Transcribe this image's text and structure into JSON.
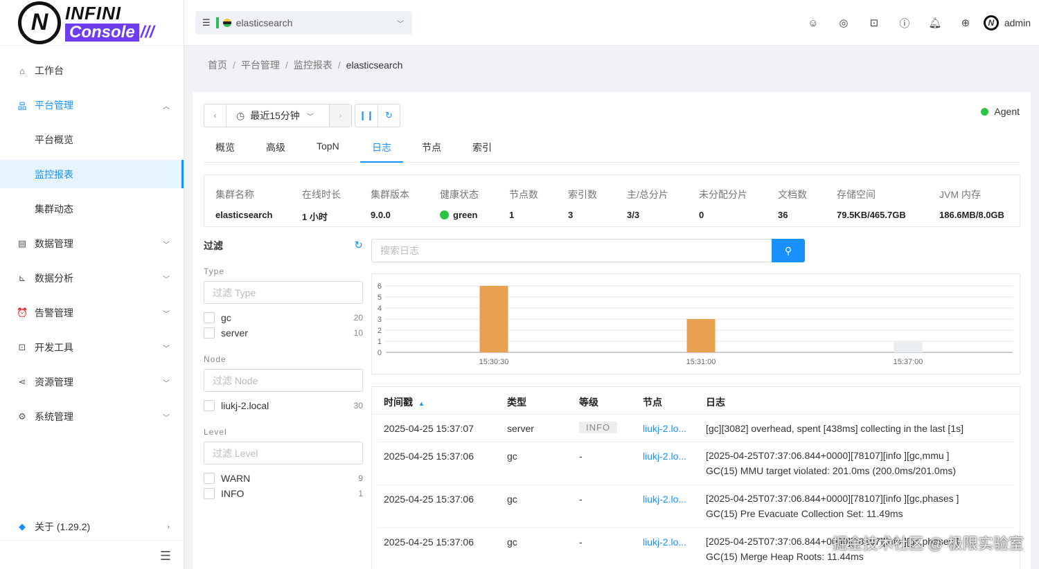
{
  "logo": {
    "text1": "INFINI",
    "text2": "Console",
    "slashes": "///"
  },
  "sidebar": {
    "items": [
      {
        "label": "工作台",
        "icon": "home-icon"
      },
      {
        "label": "平台管理",
        "icon": "cluster-icon"
      },
      {
        "label": "平台概览"
      },
      {
        "label": "监控报表"
      },
      {
        "label": "集群动态"
      },
      {
        "label": "数据管理",
        "icon": "database-icon"
      },
      {
        "label": "数据分析",
        "icon": "chart-icon"
      },
      {
        "label": "告警管理",
        "icon": "alarm-icon"
      },
      {
        "label": "开发工具",
        "icon": "terminal-icon"
      },
      {
        "label": "资源管理",
        "icon": "share-icon"
      },
      {
        "label": "系统管理",
        "icon": "gear-icon"
      },
      {
        "label": "关于 (1.29.2)",
        "icon": "diamond-icon"
      }
    ]
  },
  "header": {
    "cluster": "elasticsearch",
    "user": "admin"
  },
  "breadcrumb": [
    "首页",
    "平台管理",
    "监控报表",
    "elasticsearch"
  ],
  "toolbar": {
    "time_range": "最近15分钟"
  },
  "agent": {
    "label": "Agent",
    "color": "#29c541"
  },
  "tabs": [
    "概览",
    "高级",
    "TopN",
    "日志",
    "节点",
    "索引"
  ],
  "stats": [
    {
      "label": "集群名称",
      "value": "elasticsearch"
    },
    {
      "label": "在线时长",
      "value": "1 小时"
    },
    {
      "label": "集群版本",
      "value": "9.0.0"
    },
    {
      "label": "健康状态",
      "value": "green"
    },
    {
      "label": "节点数",
      "value": "1"
    },
    {
      "label": "索引数",
      "value": "3"
    },
    {
      "label": "主/总分片",
      "value": "3/3"
    },
    {
      "label": "未分配分片",
      "value": "0"
    },
    {
      "label": "文档数",
      "value": "36"
    },
    {
      "label": "存储空间",
      "value": "79.5KB/465.7GB"
    },
    {
      "label": "JVM 内存",
      "value": "186.6MB/8.0GB"
    }
  ],
  "filter": {
    "title": "过滤",
    "type": {
      "label": "Type",
      "placeholder": "过滤 Type",
      "options": [
        {
          "name": "gc",
          "count": "20"
        },
        {
          "name": "server",
          "count": "10"
        }
      ]
    },
    "node": {
      "label": "Node",
      "placeholder": "过滤 Node",
      "options": [
        {
          "name": "liukj-2.local",
          "count": "30"
        }
      ]
    },
    "level": {
      "label": "Level",
      "placeholder": "过滤 Level",
      "options": [
        {
          "name": "WARN",
          "count": "9"
        },
        {
          "name": "INFO",
          "count": "1"
        }
      ]
    }
  },
  "search": {
    "placeholder": "搜索日志"
  },
  "chart_data": {
    "type": "bar",
    "categories": [
      "15:30:30",
      "15:31:00",
      "15:37:00"
    ],
    "values": [
      6,
      3,
      1
    ],
    "colors": [
      "#e8a150",
      "#e8a150",
      "#eaeef0"
    ],
    "ylim": [
      0,
      6
    ],
    "yticks": [
      0,
      1,
      2,
      3,
      4,
      5,
      6
    ],
    "title": "",
    "xlabel": "",
    "ylabel": "",
    "grid": true
  },
  "log_table": {
    "columns": [
      "时间戳",
      "类型",
      "等级",
      "节点",
      "日志"
    ],
    "rows": [
      {
        "time": "2025-04-25 15:37:07",
        "type": "server",
        "level": "INFO",
        "node": "liukj-2.lo...",
        "msg1": "[gc][3082] overhead, spent [438ms] collecting in the last [1s]",
        "msg2": ""
      },
      {
        "time": "2025-04-25 15:37:06",
        "type": "gc",
        "level": "-",
        "node": "liukj-2.lo...",
        "msg1": "[2025-04-25T07:37:06.844+0000][78107][info ][gc,mmu ]",
        "msg2": "GC(15) MMU target violated: 201.0ms (200.0ms/201.0ms)"
      },
      {
        "time": "2025-04-25 15:37:06",
        "type": "gc",
        "level": "-",
        "node": "liukj-2.lo...",
        "msg1": "[2025-04-25T07:37:06.844+0000][78107][info ][gc,phases ]",
        "msg2": "GC(15) Pre Evacuate Collection Set: 11.49ms"
      },
      {
        "time": "2025-04-25 15:37:06",
        "type": "gc",
        "level": "-",
        "node": "liukj-2.lo...",
        "msg1": "[2025-04-25T07:37:06.844+0000][78107][info ][gc,phases ]",
        "msg2": "GC(15) Merge Heap Roots: 11.44ms"
      }
    ]
  },
  "watermark": "掘金技术社区 @ 极限实验室"
}
